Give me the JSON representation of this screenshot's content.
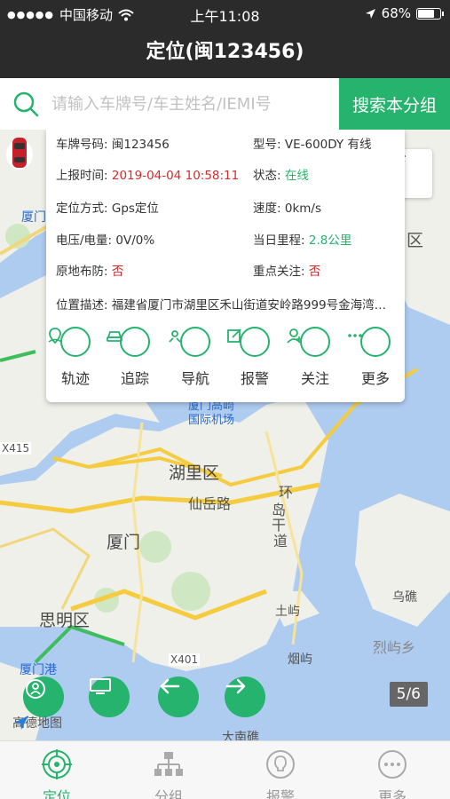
{
  "status_bar": {
    "carrier": "中国移动",
    "time": "上午11:08",
    "battery": "68%"
  },
  "nav": {
    "title": "定位(闽123456)"
  },
  "search": {
    "placeholder": "请输入车牌号/车主姓名/IEMI号",
    "button": "搜索本分组"
  },
  "info": {
    "plate_label": "车牌号码:",
    "plate_value": "闽123456",
    "model_label": "型号:",
    "model_value": "VE-600DY 有线",
    "report_label": "上报时间:",
    "report_value": "2019-04-04 10:58:11",
    "state_label": "状态:",
    "state_value": "在线",
    "locmode_label": "定位方式:",
    "locmode_value": "Gps定位",
    "speed_label": "速度:",
    "speed_value": "0km/s",
    "voltage_label": "电压/电量:",
    "voltage_value": "0V/0%",
    "mileage_label": "当日里程:",
    "mileage_value": "2.8公里",
    "defense_label": "原地布防:",
    "defense_value": "否",
    "focus_label": "重点关注:",
    "focus_value": "否",
    "address_label": "位置描述:",
    "address_value": "福建省厦门市湖里区禾山街道安岭路999号金海湾…"
  },
  "actions": [
    {
      "label": "轨迹",
      "icon": "track-icon"
    },
    {
      "label": "追踪",
      "icon": "car-track-icon"
    },
    {
      "label": "导航",
      "icon": "navigate-icon"
    },
    {
      "label": "报警",
      "icon": "alarm-edit-icon"
    },
    {
      "label": "关注",
      "icon": "follow-user-icon"
    },
    {
      "label": "更多",
      "icon": "more-icon"
    }
  ],
  "map": {
    "labels": {
      "xiamen_top": "厦门",
      "huli": "湖里区",
      "xianyue": "仙岳路",
      "huandao1": "环",
      "huandao2": "岛",
      "huandao3": "干",
      "huandao4": "道",
      "xiamen": "厦门",
      "siming": "思明区",
      "xiamen_port": "厦门港",
      "tuyu": "土屿",
      "yanyu": "烟屿",
      "wujiao": "乌礁",
      "lieyu": "烈屿乡",
      "danan": "大南礁",
      "x401": "X401",
      "x415": "X415",
      "airport": "厦门高崎国际机场",
      "qu_right": "区"
    },
    "pager": "5/6",
    "provider": "高德地图"
  },
  "tabbar": [
    {
      "label": "定位",
      "active": true
    },
    {
      "label": "分组",
      "active": false
    },
    {
      "label": "报警",
      "active": false
    },
    {
      "label": "更多",
      "active": false
    }
  ],
  "colors": {
    "accent": "#26b36d",
    "topbar": "#2b2b2b",
    "alert": "#d42b2b"
  }
}
